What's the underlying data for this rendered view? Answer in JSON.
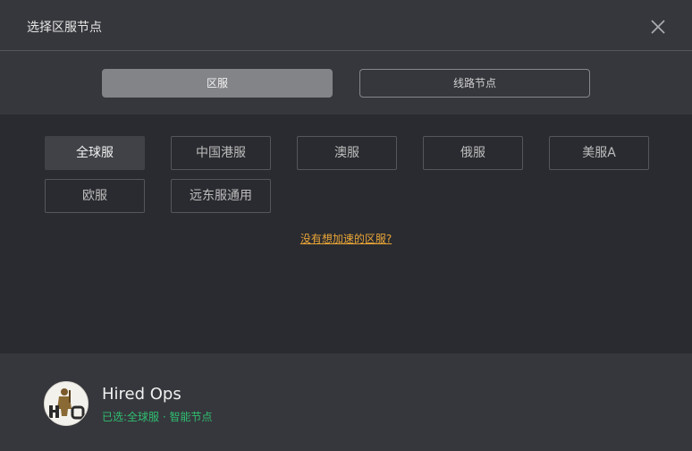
{
  "dialog": {
    "title": "选择区服节点"
  },
  "toggle": {
    "region_label": "区服",
    "node_label": "线路节点"
  },
  "regions": [
    {
      "label": "全球服"
    },
    {
      "label": "中国港服"
    },
    {
      "label": "澳服"
    },
    {
      "label": "俄服"
    },
    {
      "label": "美服A"
    },
    {
      "label": "欧服"
    },
    {
      "label": "远东服通用"
    }
  ],
  "help_link": "没有想加速的区服?",
  "footer": {
    "game_name": "Hired Ops",
    "selected_prefix": "已选:",
    "selected_region": "全球服",
    "separator": "·",
    "selected_node": "智能节点"
  },
  "colors": {
    "accent_link": "#e8a437",
    "selected_text": "#2fbf71"
  }
}
